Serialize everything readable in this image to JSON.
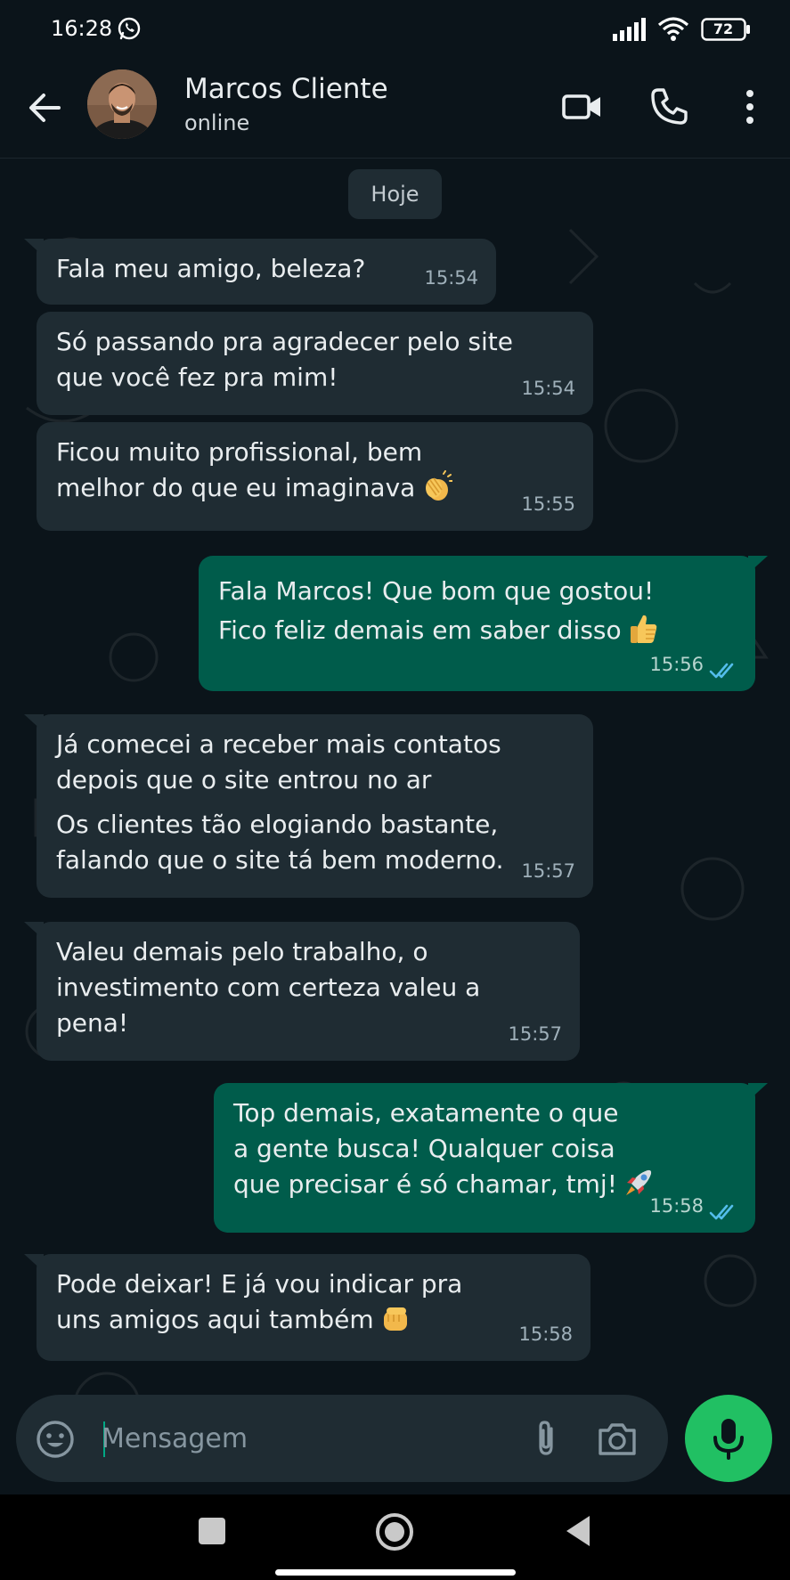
{
  "status_bar": {
    "time": "16:28",
    "battery": "72"
  },
  "header": {
    "contact_name": "Marcos Cliente",
    "contact_status": "online"
  },
  "chat": {
    "date_chip": "Hoje",
    "messages": [
      {
        "direction": "in",
        "text": "Fala meu amigo, beleza?",
        "time": "15:54"
      },
      {
        "direction": "in",
        "text": "Só passando pra agradecer pelo site\nque você fez pra mim!",
        "time": "15:54"
      },
      {
        "direction": "in",
        "text": "Ficou muito profissional, bem\nmelhor do que eu imaginava",
        "emoji": "clapping-hands-icon",
        "time": "15:55"
      },
      {
        "direction": "out",
        "text": "Fala Marcos! Que bom que gostou!\nFico feliz demais em saber disso",
        "emoji": "thumbs-up-icon",
        "time": "15:56",
        "read": true
      },
      {
        "direction": "in",
        "text": "Já comecei a receber mais contatos\ndepois que o site entrou no ar",
        "text2": "Os clientes tão elogiando bastante,\nfalando que o site tá bem moderno.",
        "time": "15:57"
      },
      {
        "direction": "in",
        "text": "Valeu demais pelo trabalho, o\ninvestimento com certeza valeu a\npena!",
        "time": "15:57"
      },
      {
        "direction": "out",
        "text": "Top demais, exatamente o que\na gente busca! Qualquer coisa\nque precisar é só chamar, tmj!",
        "emoji": "rocket-icon",
        "time": "15:58",
        "read": true
      },
      {
        "direction": "in",
        "text": "Pode deixar! E já vou indicar pra\nuns amigos aqui também",
        "emoji": "fist-bump-icon",
        "time": "15:58"
      }
    ]
  },
  "input": {
    "placeholder": "Mensagem"
  },
  "colors": {
    "background": "#0b141a",
    "incoming_bubble": "#1f2c33",
    "outgoing_bubble": "#005c4b",
    "accent": "#21c063",
    "read_ticks": "#53bdeb"
  }
}
